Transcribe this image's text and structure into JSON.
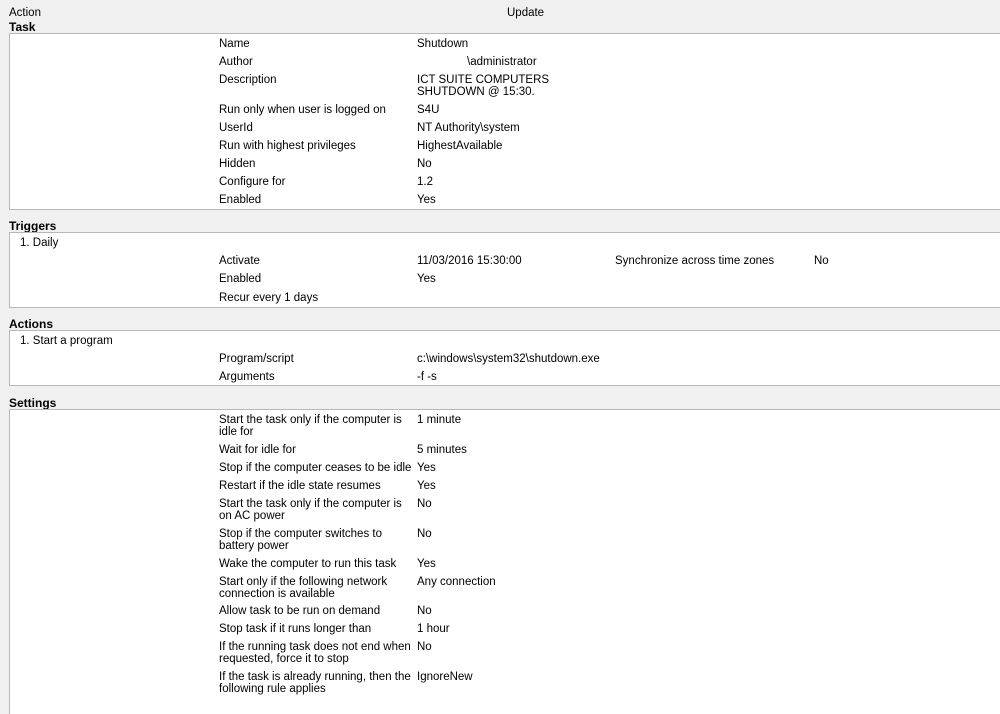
{
  "header": {
    "left": "Action",
    "center": "Update"
  },
  "task": {
    "title": "Task",
    "rows": [
      {
        "label": "Name",
        "value": "Shutdown"
      },
      {
        "label": "Author",
        "value": "\\administrator"
      },
      {
        "label": "Description",
        "value": "ICT SUITE COMPUTERS",
        "value2": "SHUTDOWN @ 15:30."
      },
      {
        "label": "Run only when user is logged on",
        "value": "S4U"
      },
      {
        "label": "UserId",
        "value": "NT Authority\\system"
      },
      {
        "label": "Run with highest privileges",
        "value": "HighestAvailable"
      },
      {
        "label": "Hidden",
        "value": "No"
      },
      {
        "label": "Configure for",
        "value": "1.2"
      },
      {
        "label": "Enabled",
        "value": "Yes"
      }
    ]
  },
  "triggers": {
    "title": "Triggers",
    "item": "1. Daily",
    "rows": [
      {
        "label": "Activate",
        "value": "11/03/2016 15:30:00",
        "label2": "Synchronize across time zones",
        "value2": "No"
      },
      {
        "label": "Enabled",
        "value": "Yes"
      },
      {
        "label": "Recur every 1 days",
        "value": ""
      }
    ]
  },
  "actions": {
    "title": "Actions",
    "item": "1. Start a program",
    "rows": [
      {
        "label": "Program/script",
        "value": "c:\\windows\\system32\\shutdown.exe"
      },
      {
        "label": "Arguments",
        "value": "-f -s"
      }
    ]
  },
  "settings": {
    "title": "Settings",
    "rows": [
      {
        "label": "Start the task only if the computer is",
        "label2": "idle for",
        "value": "1 minute"
      },
      {
        "label": "Wait for idle for",
        "value": "5 minutes"
      },
      {
        "label": "Stop if the computer ceases to be idle",
        "value": "Yes"
      },
      {
        "label": "Restart if the idle state resumes",
        "value": "Yes"
      },
      {
        "label": "Start the task only if the computer is",
        "label2": "on AC power",
        "value": "No"
      },
      {
        "label": "Stop if the computer switches to",
        "label2": "battery power",
        "value": "No"
      },
      {
        "label": "Wake the computer to run this task",
        "value": "Yes"
      },
      {
        "label": "Start only if the following network",
        "label2": "connection is available",
        "value": "Any connection"
      },
      {
        "label": "Allow task to be run on demand",
        "value": "No"
      },
      {
        "label": "Stop task if it runs longer than",
        "value": "1 hour"
      },
      {
        "label": "If the running task does not end when",
        "label2": "requested, force it to stop",
        "value": "No"
      },
      {
        "label": "If the task is already running, then the",
        "label2": "following rule applies",
        "value": "IgnoreNew"
      }
    ]
  }
}
